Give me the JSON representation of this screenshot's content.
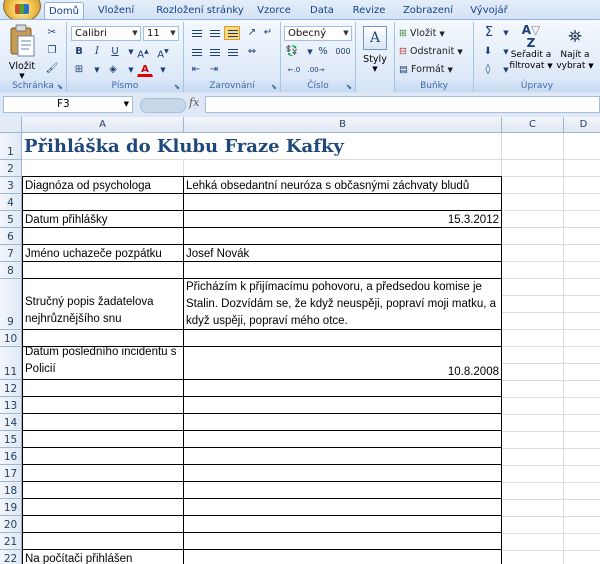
{
  "ribbon_tabs": [
    "Domů",
    "Vložení",
    "Rozložení stránky",
    "Vzorce",
    "Data",
    "Revize",
    "Zobrazení",
    "Vývojář"
  ],
  "groups": {
    "clipboard": {
      "title": "Schránka",
      "paste": "Vložit"
    },
    "font": {
      "title": "Písmo",
      "font_name": "Calibri",
      "font_size": "11",
      "bold": "B",
      "italic": "I",
      "underline": "U"
    },
    "alignment": {
      "title": "Zarovnání"
    },
    "number": {
      "title": "Číslo",
      "format": "Obecný",
      "percent": "%",
      "thousands": "000"
    },
    "styles": {
      "label": "Styly"
    },
    "cells": {
      "title": "Buňky",
      "insert": "Vložit",
      "delete": "Odstranit",
      "format": "Formát"
    },
    "editing": {
      "title": "Úpravy",
      "sigma": "Σ",
      "sort": [
        "Seřadit a",
        "filtrovat"
      ],
      "find": [
        "Najít a",
        "vybrat"
      ]
    }
  },
  "formula_bar": {
    "name_box": "F3",
    "fx": "fx",
    "content": ""
  },
  "columns": [
    "A",
    "B",
    "C",
    "D"
  ],
  "rows": [
    "1",
    "2",
    "3",
    "4",
    "5",
    "6",
    "7",
    "8",
    "9",
    "10",
    "11",
    "12",
    "13",
    "14",
    "15",
    "16",
    "17",
    "18",
    "19",
    "20",
    "21",
    "22"
  ],
  "sheet": {
    "title": "Přihláška do Klubu Fraze Kafky",
    "diagnosis_label": "Diagnóza od psychologa",
    "diagnosis_value": "Lehká obsedantní neuróza s občasnými záchvaty bludů",
    "date_label": "Datum přihlášky",
    "date_value": "15.3.2012",
    "name_label": "Jméno uchazeče pozpátku",
    "name_value": "Josef Novák",
    "dream_label": "Stručný popis žadatelova nejhrůznějšího snu",
    "dream_value": "Přicházím k přijímacímu pohovoru, a předsedou komise je Stalin. Dozvídám se, že když neuspěji, popraví moji matku, a když uspěji, popraví mého otce.",
    "incident_label": "Datum posledního incidentu s Policií",
    "incident_value": "10.8.2008",
    "computer_label": "Na počítači přihlášen"
  }
}
